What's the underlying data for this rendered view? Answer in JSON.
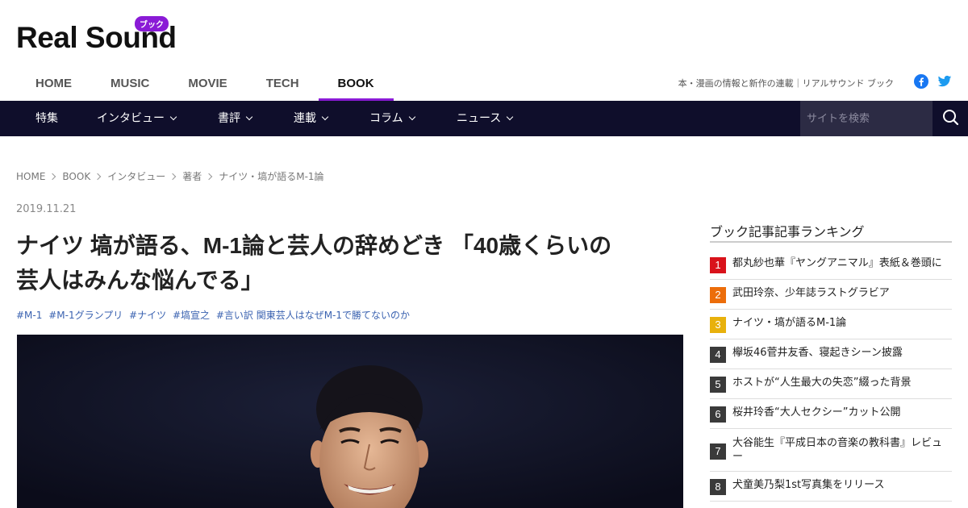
{
  "logo": {
    "text": "Real Sound",
    "badge": "ブック"
  },
  "topnav": [
    "HOME",
    "MUSIC",
    "MOVIE",
    "TECH",
    "BOOK"
  ],
  "active_section": "BOOK",
  "tagline": "本・漫画の情報と新作の連載｜リアルサウンド ブック",
  "sns": {
    "facebook_icon": "facebook-icon",
    "twitter_icon": "twitter-icon"
  },
  "categories": [
    "特集",
    "インタビュー",
    "書評",
    "連載",
    "コラム",
    "ニュース"
  ],
  "search": {
    "placeholder": "サイトを検索"
  },
  "breadcrumb": [
    "HOME",
    "BOOK",
    "インタビュー",
    "著者",
    "ナイツ・塙が語るM-1論"
  ],
  "article": {
    "date": "2019.11.21",
    "title_line1": "ナイツ 塙が語る、M-1論と芸人の辞めどき 「40歳くらいの",
    "title_line2": "芸人はみんな悩んでる」",
    "tags": [
      "#M-1",
      "#M-1グランプリ",
      "#ナイツ",
      "#塙宣之",
      "#言い訳 関東芸人はなぜM-1で勝てないのか"
    ]
  },
  "ranking": {
    "title": "ブック記事記事ランキング",
    "items": [
      {
        "rank": "1",
        "text": "都丸紗也華『ヤングアニマル』表紙＆巻頭に",
        "color": "#d9121b"
      },
      {
        "rank": "2",
        "text": "武田玲奈、少年誌ラストグラビア",
        "color": "#ec6d0a"
      },
      {
        "rank": "3",
        "text": "ナイツ・塙が語るM-1論",
        "color": "#e8b10c"
      },
      {
        "rank": "4",
        "text": "欅坂46菅井友香、寝起きシーン披露",
        "color": "#3a3a3a"
      },
      {
        "rank": "5",
        "text": "ホストが“人生最大の失恋”綴った背景",
        "color": "#3a3a3a"
      },
      {
        "rank": "6",
        "text": "桜井玲香“大人セクシー”カット公開",
        "color": "#3a3a3a"
      },
      {
        "rank": "7",
        "text": "大谷能生『平成日本の音楽の教科書』レビュー",
        "color": "#3a3a3a"
      },
      {
        "rank": "8",
        "text": "犬童美乃梨1st写真集をリリース",
        "color": "#3a3a3a"
      }
    ]
  },
  "colors": {
    "accent": "#8a1bd6",
    "catbar": "#0f0e2b",
    "link": "#3a62b0"
  }
}
